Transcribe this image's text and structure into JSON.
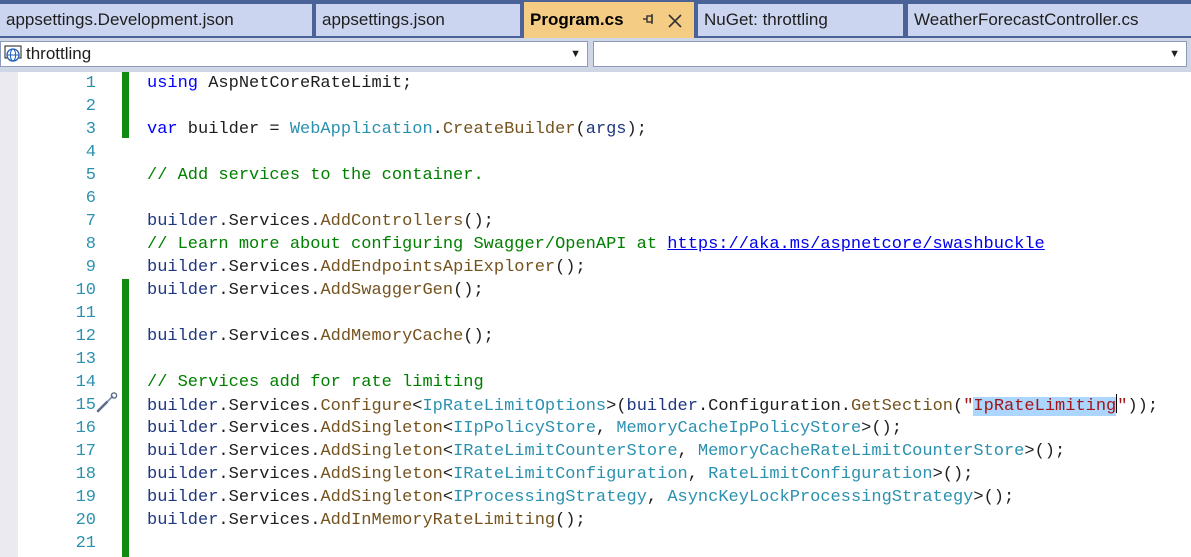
{
  "tabs": [
    {
      "label": "appsettings.Development.json",
      "active": false
    },
    {
      "label": "appsettings.json",
      "active": false
    },
    {
      "label": "Program.cs",
      "active": true
    },
    {
      "label": "NuGet: throttling",
      "active": false
    },
    {
      "label": "WeatherForecastController.cs",
      "active": false
    }
  ],
  "tab_icons": {
    "pin": "pin-icon",
    "close": "close-icon"
  },
  "navbar": {
    "project_selector": "throttling",
    "member_selector": "",
    "icons": {
      "project": "globe-icon",
      "dropdown": "chevron-down-icon"
    }
  },
  "editor": {
    "line_numbers": [
      "1",
      "2",
      "3",
      "4",
      "5",
      "6",
      "7",
      "8",
      "9",
      "10",
      "11",
      "12",
      "13",
      "14",
      "15",
      "16",
      "17",
      "18",
      "19",
      "20",
      "21"
    ],
    "line15_glyph": "screwdriver-icon",
    "lines": [
      [
        {
          "t": "using",
          "c": "kw"
        },
        {
          "t": " AspNetCoreRateLimit;",
          "c": ""
        }
      ],
      [],
      [
        {
          "t": "var",
          "c": "kw"
        },
        {
          "t": " builder = ",
          "c": ""
        },
        {
          "t": "WebApplication",
          "c": "ty"
        },
        {
          "t": ".",
          "c": ""
        },
        {
          "t": "CreateBuilder",
          "c": "me"
        },
        {
          "t": "(",
          "c": ""
        },
        {
          "t": "args",
          "c": "pa"
        },
        {
          "t": ");",
          "c": ""
        }
      ],
      [],
      [
        {
          "t": "// Add services to the container.",
          "c": "co"
        }
      ],
      [],
      [
        {
          "t": "builder",
          "c": "pa"
        },
        {
          "t": ".Services.",
          "c": ""
        },
        {
          "t": "AddControllers",
          "c": "me"
        },
        {
          "t": "();",
          "c": ""
        }
      ],
      [
        {
          "t": "// Learn more about configuring Swagger/OpenAPI at ",
          "c": "co"
        },
        {
          "t": "https://aka.ms/aspnetcore/swashbuckle",
          "c": "ln"
        }
      ],
      [
        {
          "t": "builder",
          "c": "pa"
        },
        {
          "t": ".Services.",
          "c": ""
        },
        {
          "t": "AddEndpointsApiExplorer",
          "c": "me"
        },
        {
          "t": "();",
          "c": ""
        }
      ],
      [
        {
          "t": "builder",
          "c": "pa"
        },
        {
          "t": ".Services.",
          "c": ""
        },
        {
          "t": "AddSwaggerGen",
          "c": "me"
        },
        {
          "t": "();",
          "c": ""
        }
      ],
      [],
      [
        {
          "t": "builder",
          "c": "pa"
        },
        {
          "t": ".Services.",
          "c": ""
        },
        {
          "t": "AddMemoryCache",
          "c": "me"
        },
        {
          "t": "();",
          "c": ""
        }
      ],
      [],
      [
        {
          "t": "// Services add for rate limiting",
          "c": "co"
        }
      ],
      [
        {
          "t": "builder",
          "c": "pa"
        },
        {
          "t": ".Services.",
          "c": ""
        },
        {
          "t": "Configure",
          "c": "me"
        },
        {
          "t": "<",
          "c": ""
        },
        {
          "t": "IpRateLimitOptions",
          "c": "ty"
        },
        {
          "t": ">(",
          "c": ""
        },
        {
          "t": "builder",
          "c": "pa"
        },
        {
          "t": ".Configuration.",
          "c": ""
        },
        {
          "t": "GetSection",
          "c": "me"
        },
        {
          "t": "(",
          "c": ""
        },
        {
          "t": "\"",
          "c": "st"
        },
        {
          "t": "IpRateLimiting",
          "c": "st sel"
        },
        {
          "t": "CARET",
          "c": "caret"
        },
        {
          "t": "\"",
          "c": "st"
        },
        {
          "t": "));",
          "c": ""
        }
      ],
      [
        {
          "t": "builder",
          "c": "pa"
        },
        {
          "t": ".Services.",
          "c": ""
        },
        {
          "t": "AddSingleton",
          "c": "me"
        },
        {
          "t": "<",
          "c": ""
        },
        {
          "t": "IIpPolicyStore",
          "c": "ty"
        },
        {
          "t": ", ",
          "c": ""
        },
        {
          "t": "MemoryCacheIpPolicyStore",
          "c": "ty"
        },
        {
          "t": ">();",
          "c": ""
        }
      ],
      [
        {
          "t": "builder",
          "c": "pa"
        },
        {
          "t": ".Services.",
          "c": ""
        },
        {
          "t": "AddSingleton",
          "c": "me"
        },
        {
          "t": "<",
          "c": ""
        },
        {
          "t": "IRateLimitCounterStore",
          "c": "ty"
        },
        {
          "t": ", ",
          "c": ""
        },
        {
          "t": "MemoryCacheRateLimitCounterStore",
          "c": "ty"
        },
        {
          "t": ">();",
          "c": ""
        }
      ],
      [
        {
          "t": "builder",
          "c": "pa"
        },
        {
          "t": ".Services.",
          "c": ""
        },
        {
          "t": "AddSingleton",
          "c": "me"
        },
        {
          "t": "<",
          "c": ""
        },
        {
          "t": "IRateLimitConfiguration",
          "c": "ty"
        },
        {
          "t": ", ",
          "c": ""
        },
        {
          "t": "RateLimitConfiguration",
          "c": "ty"
        },
        {
          "t": ">();",
          "c": ""
        }
      ],
      [
        {
          "t": "builder",
          "c": "pa"
        },
        {
          "t": ".Services.",
          "c": ""
        },
        {
          "t": "AddSingleton",
          "c": "me"
        },
        {
          "t": "<",
          "c": ""
        },
        {
          "t": "IProcessingStrategy",
          "c": "ty"
        },
        {
          "t": ", ",
          "c": ""
        },
        {
          "t": "AsyncKeyLockProcessingStrategy",
          "c": "ty"
        },
        {
          "t": ">();",
          "c": ""
        }
      ],
      [
        {
          "t": "builder",
          "c": "pa"
        },
        {
          "t": ".Services.",
          "c": ""
        },
        {
          "t": "AddInMemoryRateLimiting",
          "c": "me"
        },
        {
          "t": "();",
          "c": ""
        }
      ],
      []
    ],
    "colors": {
      "keyword": "#0000ff",
      "type": "#2b91af",
      "method": "#74531f",
      "local": "#1f377f",
      "comment": "#008000",
      "string": "#a31515",
      "line_number": "#2b91af",
      "change_marker": "#108a10",
      "active_tab": "#f5cc84",
      "tab_strip": "#4b6299"
    }
  }
}
